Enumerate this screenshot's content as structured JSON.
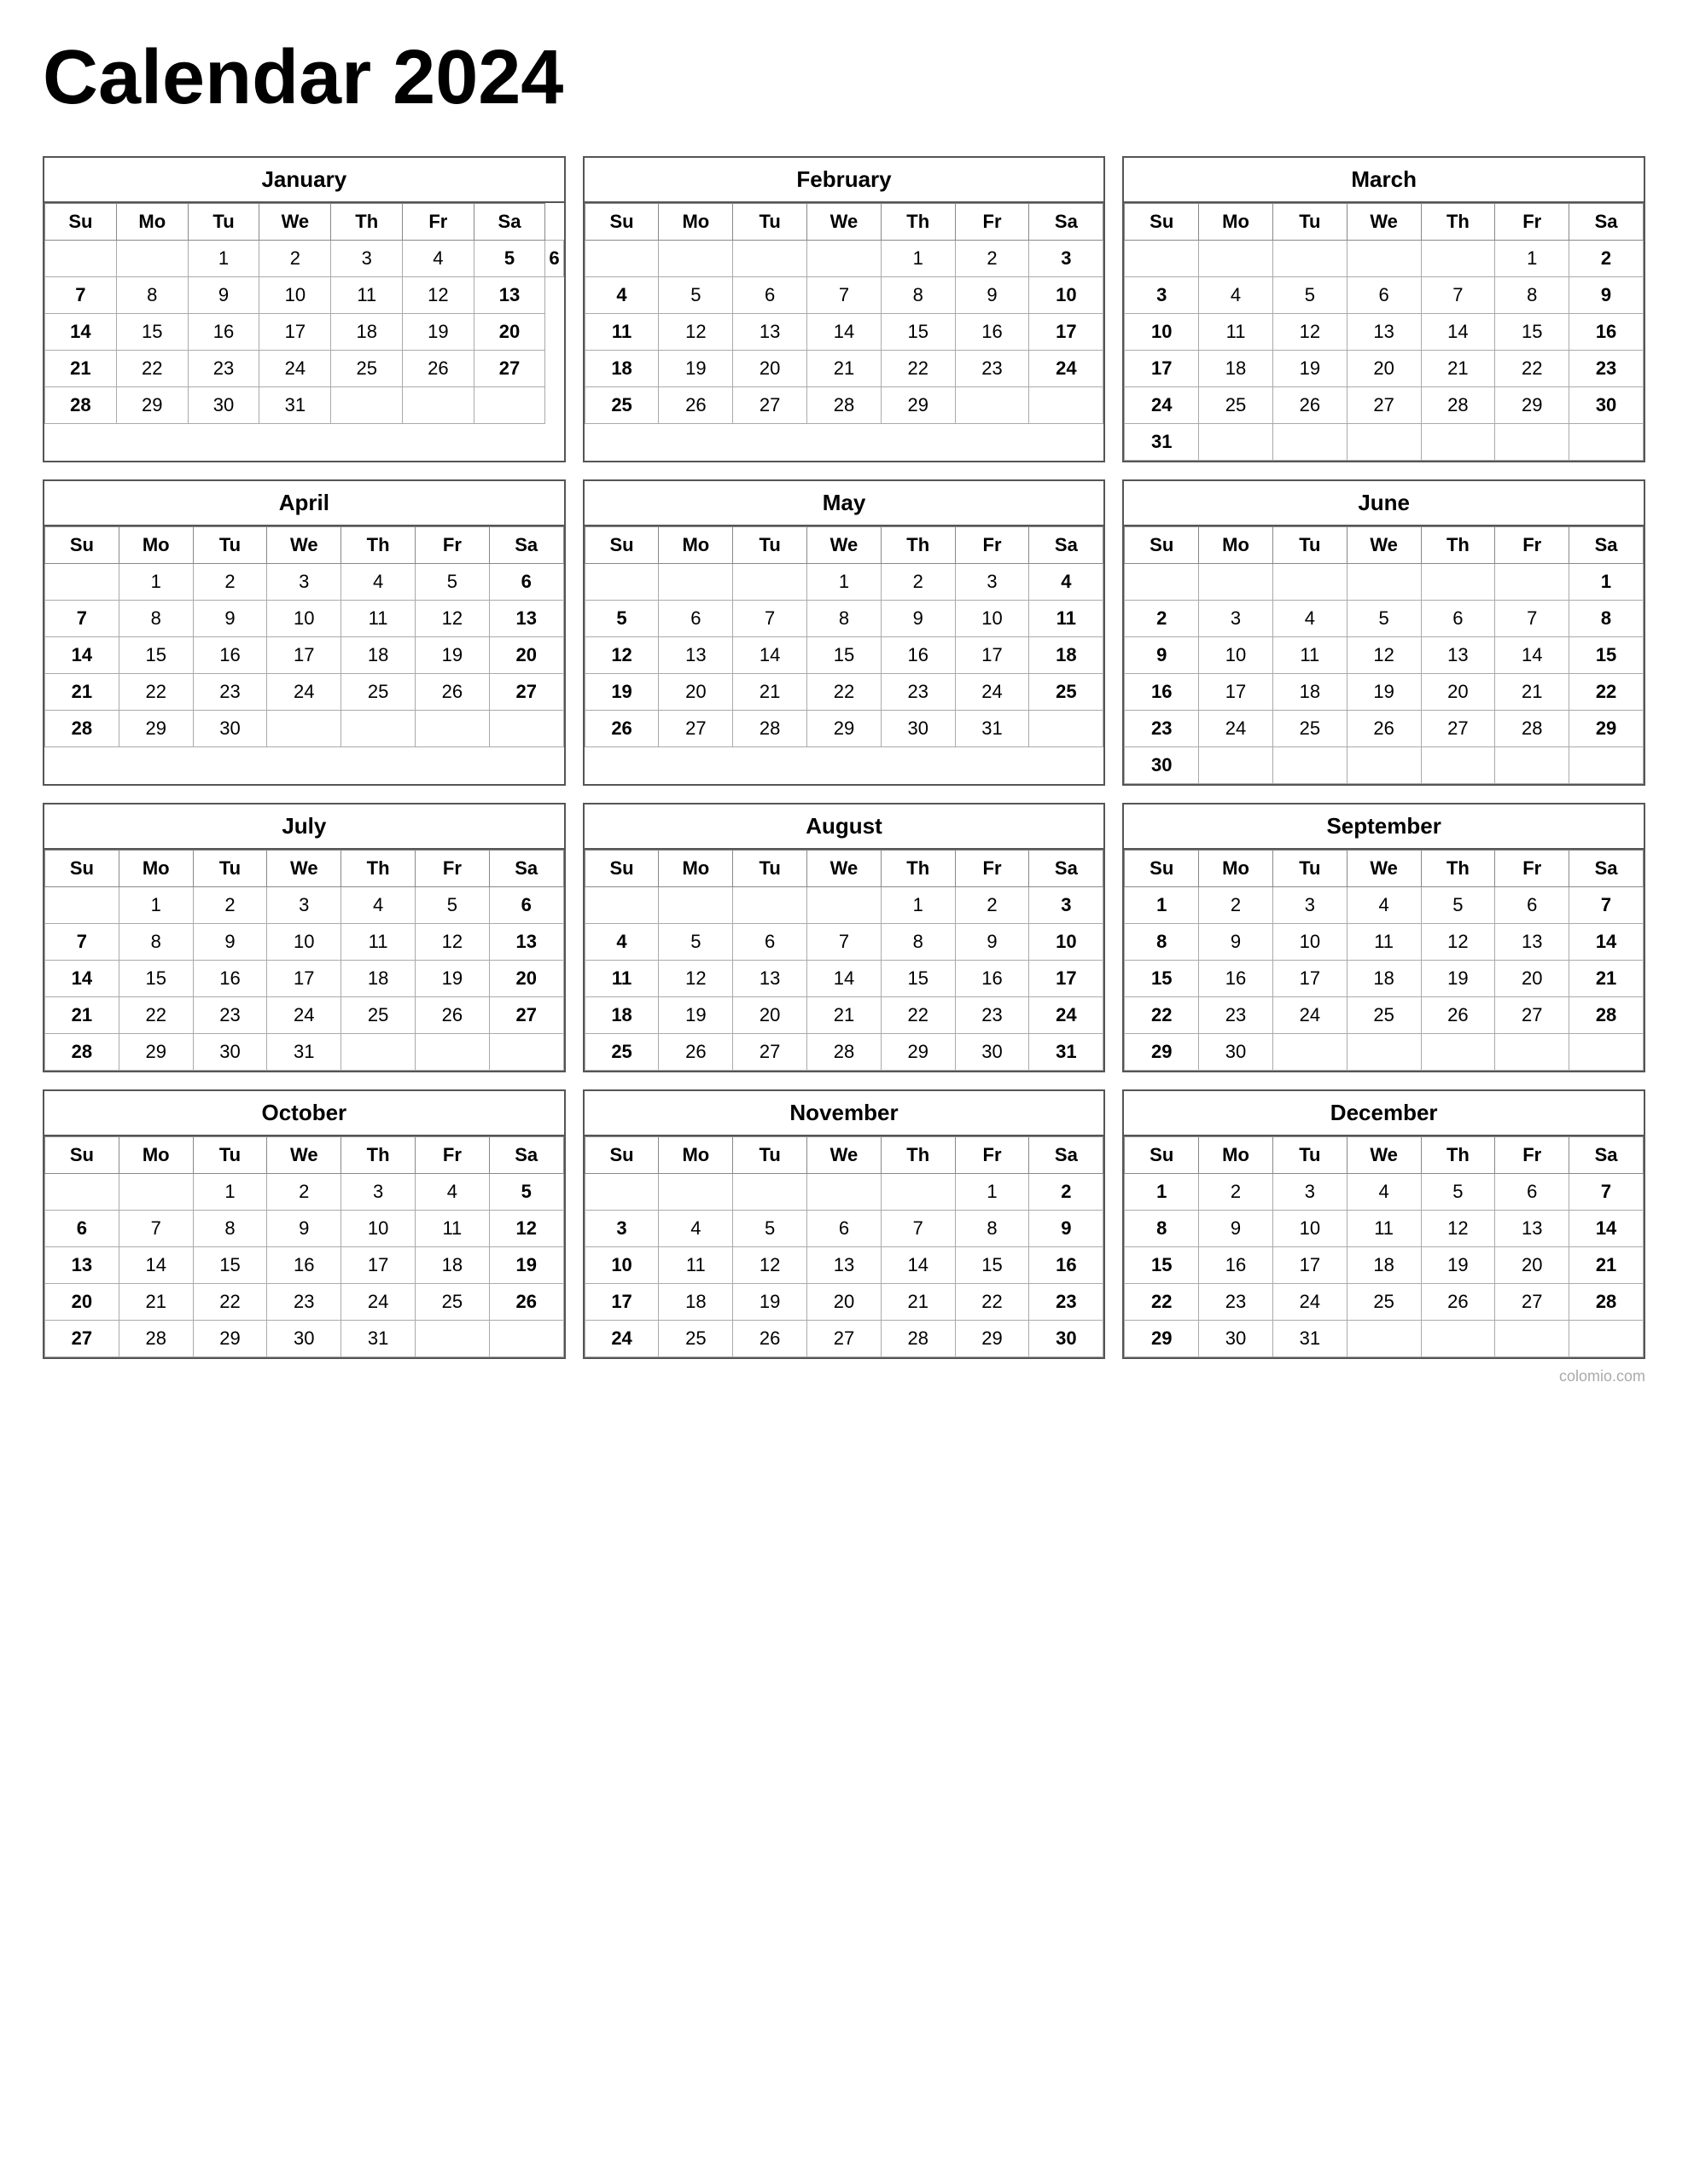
{
  "title": "Calendar 2024",
  "months": [
    {
      "name": "January",
      "weeks": [
        [
          "",
          "",
          1,
          2,
          3,
          4,
          5,
          6
        ],
        [
          7,
          8,
          9,
          10,
          11,
          12,
          13
        ],
        [
          14,
          15,
          16,
          17,
          18,
          19,
          20
        ],
        [
          21,
          22,
          23,
          24,
          25,
          26,
          27
        ],
        [
          28,
          29,
          30,
          31,
          "",
          "",
          ""
        ]
      ]
    },
    {
      "name": "February",
      "weeks": [
        [
          "",
          "",
          "",
          "",
          1,
          2,
          3
        ],
        [
          4,
          5,
          6,
          7,
          8,
          9,
          10
        ],
        [
          11,
          12,
          13,
          14,
          15,
          16,
          17
        ],
        [
          18,
          19,
          20,
          21,
          22,
          23,
          24
        ],
        [
          25,
          26,
          27,
          28,
          29,
          "",
          ""
        ]
      ]
    },
    {
      "name": "March",
      "weeks": [
        [
          "",
          "",
          "",
          "",
          "",
          1,
          2
        ],
        [
          3,
          4,
          5,
          6,
          7,
          8,
          9
        ],
        [
          10,
          11,
          12,
          13,
          14,
          15,
          16
        ],
        [
          17,
          18,
          19,
          20,
          21,
          22,
          23
        ],
        [
          24,
          25,
          26,
          27,
          28,
          29,
          30
        ],
        [
          31,
          "",
          "",
          "",
          "",
          "",
          ""
        ]
      ]
    },
    {
      "name": "April",
      "weeks": [
        [
          "",
          1,
          2,
          3,
          4,
          5,
          6
        ],
        [
          7,
          8,
          9,
          10,
          11,
          12,
          13
        ],
        [
          14,
          15,
          16,
          17,
          18,
          19,
          20
        ],
        [
          21,
          22,
          23,
          24,
          25,
          26,
          27
        ],
        [
          28,
          29,
          30,
          "",
          "",
          "",
          ""
        ]
      ]
    },
    {
      "name": "May",
      "weeks": [
        [
          "",
          "",
          "",
          1,
          2,
          3,
          4
        ],
        [
          5,
          6,
          7,
          8,
          9,
          10,
          11
        ],
        [
          12,
          13,
          14,
          15,
          16,
          17,
          18
        ],
        [
          19,
          20,
          21,
          22,
          23,
          24,
          25
        ],
        [
          26,
          27,
          28,
          29,
          30,
          31,
          ""
        ]
      ]
    },
    {
      "name": "June",
      "weeks": [
        [
          "",
          "",
          "",
          "",
          "",
          "",
          1
        ],
        [
          2,
          3,
          4,
          5,
          6,
          7,
          8
        ],
        [
          9,
          10,
          11,
          12,
          13,
          14,
          15
        ],
        [
          16,
          17,
          18,
          19,
          20,
          21,
          22
        ],
        [
          23,
          24,
          25,
          26,
          27,
          28,
          29
        ],
        [
          30,
          "",
          "",
          "",
          "",
          "",
          ""
        ]
      ]
    },
    {
      "name": "July",
      "weeks": [
        [
          "",
          1,
          2,
          3,
          4,
          5,
          6
        ],
        [
          7,
          8,
          9,
          10,
          11,
          12,
          13
        ],
        [
          14,
          15,
          16,
          17,
          18,
          19,
          20
        ],
        [
          21,
          22,
          23,
          24,
          25,
          26,
          27
        ],
        [
          28,
          29,
          30,
          31,
          "",
          "",
          ""
        ]
      ]
    },
    {
      "name": "August",
      "weeks": [
        [
          "",
          "",
          "",
          "",
          1,
          2,
          3
        ],
        [
          4,
          5,
          6,
          7,
          8,
          9,
          10
        ],
        [
          11,
          12,
          13,
          14,
          15,
          16,
          17
        ],
        [
          18,
          19,
          20,
          21,
          22,
          23,
          24
        ],
        [
          25,
          26,
          27,
          28,
          29,
          30,
          31
        ]
      ]
    },
    {
      "name": "September",
      "weeks": [
        [
          1,
          2,
          3,
          4,
          5,
          6,
          7
        ],
        [
          8,
          9,
          10,
          11,
          12,
          13,
          14
        ],
        [
          15,
          16,
          17,
          18,
          19,
          20,
          21
        ],
        [
          22,
          23,
          24,
          25,
          26,
          27,
          28
        ],
        [
          29,
          30,
          "",
          "",
          "",
          "",
          ""
        ]
      ]
    },
    {
      "name": "October",
      "weeks": [
        [
          "",
          "",
          1,
          2,
          3,
          4,
          5
        ],
        [
          6,
          7,
          8,
          9,
          10,
          11,
          12
        ],
        [
          13,
          14,
          15,
          16,
          17,
          18,
          19
        ],
        [
          20,
          21,
          22,
          23,
          24,
          25,
          26
        ],
        [
          27,
          28,
          29,
          30,
          31,
          "",
          ""
        ]
      ]
    },
    {
      "name": "November",
      "weeks": [
        [
          "",
          "",
          "",
          "",
          "",
          1,
          2
        ],
        [
          3,
          4,
          5,
          6,
          7,
          8,
          9
        ],
        [
          10,
          11,
          12,
          13,
          14,
          15,
          16
        ],
        [
          17,
          18,
          19,
          20,
          21,
          22,
          23
        ],
        [
          24,
          25,
          26,
          27,
          28,
          29,
          30
        ]
      ]
    },
    {
      "name": "December",
      "weeks": [
        [
          1,
          2,
          3,
          4,
          5,
          6,
          7
        ],
        [
          8,
          9,
          10,
          11,
          12,
          13,
          14
        ],
        [
          15,
          16,
          17,
          18,
          19,
          20,
          21
        ],
        [
          22,
          23,
          24,
          25,
          26,
          27,
          28
        ],
        [
          29,
          30,
          31,
          "",
          "",
          "",
          ""
        ]
      ]
    }
  ],
  "days": [
    "Su",
    "Mo",
    "Tu",
    "We",
    "Th",
    "Fr",
    "Sa"
  ],
  "watermark": "colomio.com"
}
